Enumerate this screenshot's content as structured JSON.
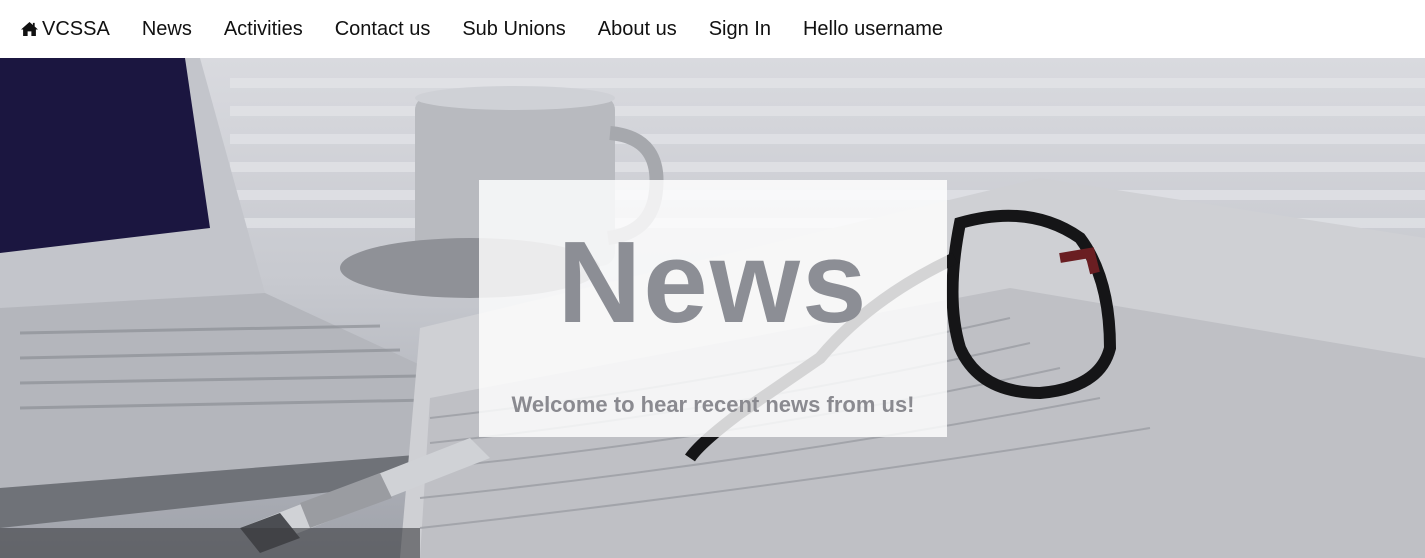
{
  "navbar": {
    "brand": {
      "label": "VCSSA",
      "icon": "home-icon"
    },
    "items": [
      {
        "label": "News"
      },
      {
        "label": "Activities"
      },
      {
        "label": "Contact us"
      },
      {
        "label": "Sub Unions"
      },
      {
        "label": "About us"
      },
      {
        "label": "Sign In"
      },
      {
        "label": "Hello username"
      }
    ]
  },
  "hero": {
    "title": "News",
    "subtitle": "Welcome to hear recent news from us!"
  }
}
